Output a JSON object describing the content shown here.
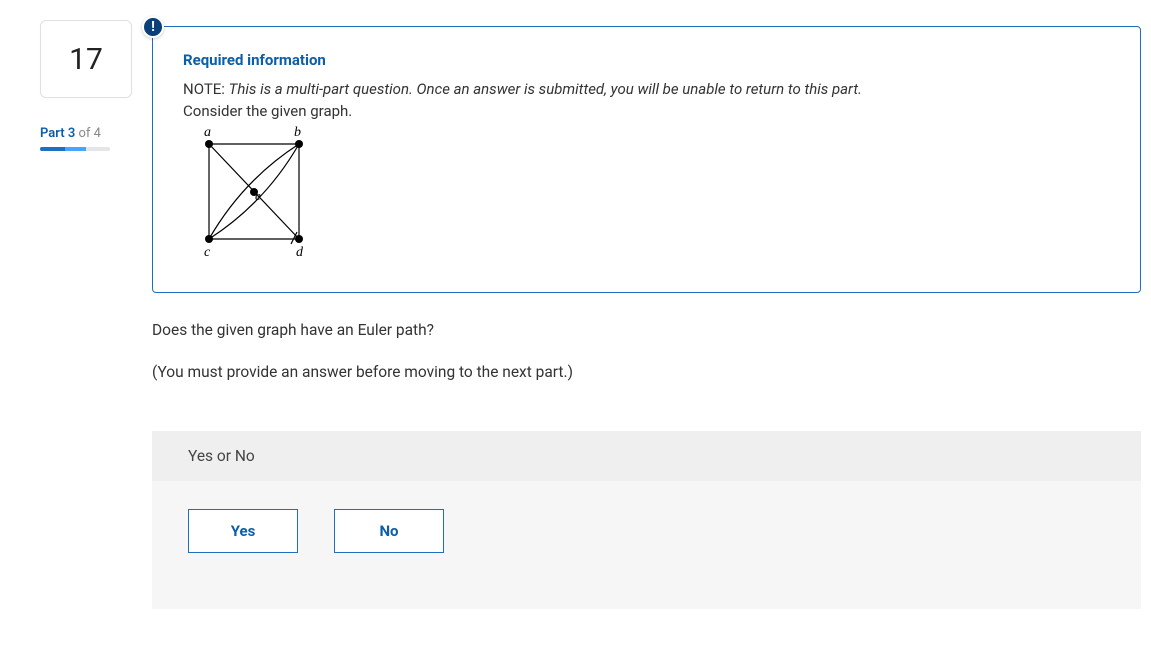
{
  "question": {
    "number": "17",
    "part_label_bold": "Part 3",
    "part_label_thin": " of 4"
  },
  "infoBox": {
    "title": "Required information",
    "note_label": "NOTE: ",
    "note_italic": "This is a multi-part question. Once an answer is submitted, you will be unable to return to this part.",
    "consider": "Consider the given graph.",
    "graph": {
      "labels": {
        "tl": "a",
        "tr": "b",
        "bl": "c",
        "br": "d",
        "center": "e"
      }
    }
  },
  "body": {
    "question_text": "Does the given graph have an Euler path?",
    "instruction": "(You must provide an answer before moving to the next part.)"
  },
  "answer": {
    "header": "Yes or No",
    "yes": "Yes",
    "no": "No"
  }
}
